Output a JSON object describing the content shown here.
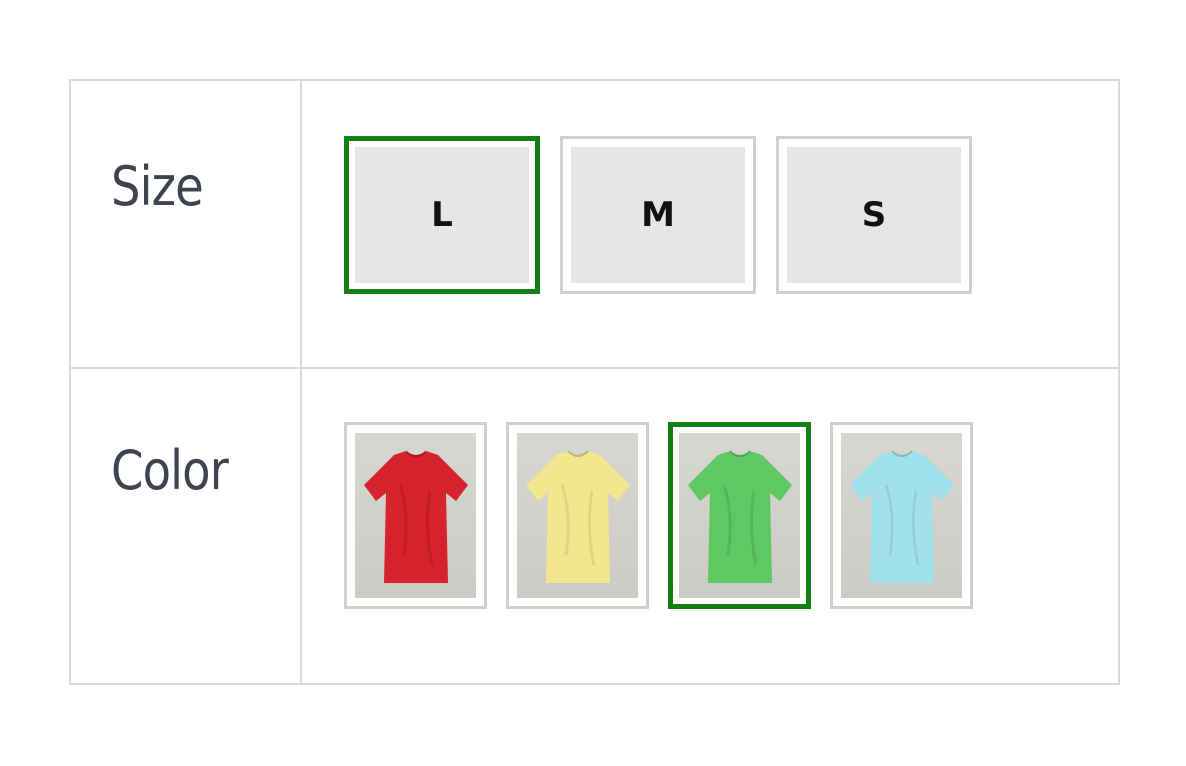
{
  "attributes": {
    "size": {
      "label": "Size",
      "options": [
        {
          "value": "L",
          "selected": true
        },
        {
          "value": "M",
          "selected": false
        },
        {
          "value": "S",
          "selected": false
        }
      ]
    },
    "color": {
      "label": "Color",
      "options": [
        {
          "name": "red",
          "hex": "#d8232f",
          "selected": false
        },
        {
          "name": "yellow",
          "hex": "#f2e68f",
          "selected": false
        },
        {
          "name": "green",
          "hex": "#5fc862",
          "selected": true
        },
        {
          "name": "light-blue",
          "hex": "#9fe0ea",
          "selected": false
        }
      ]
    }
  },
  "colors": {
    "selected_border": "#138012",
    "swatch_border": "#cfcfcf",
    "table_border": "#d9d9d9",
    "label_text": "#3f4350",
    "swatch_fill": "#e6e6e6"
  },
  "icons": {
    "shirt": "tshirt-icon"
  }
}
